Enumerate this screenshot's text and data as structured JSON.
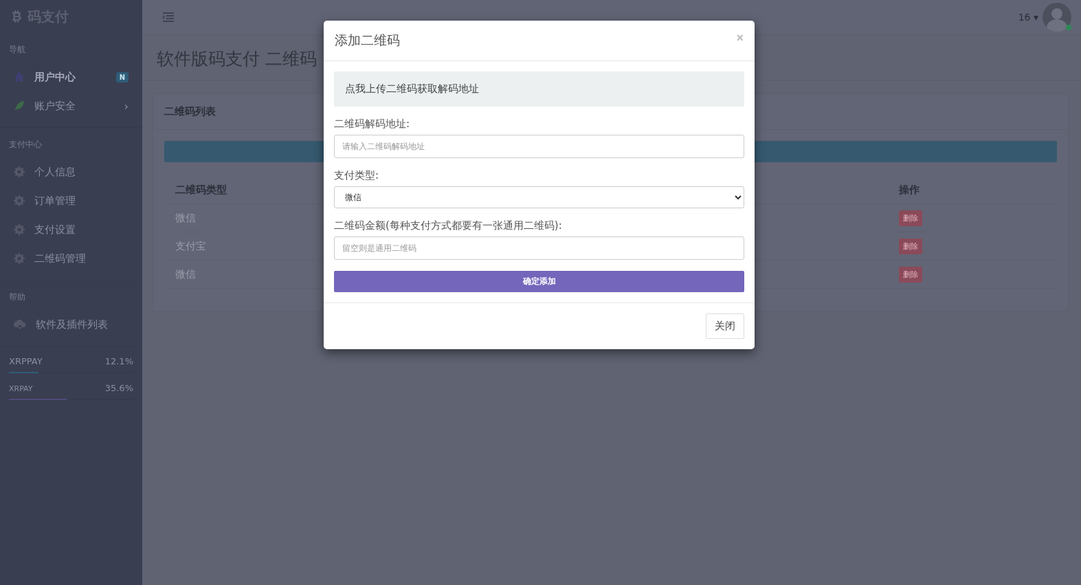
{
  "brand": {
    "name": "码支付"
  },
  "sidebar": {
    "sections": [
      {
        "title": "导航",
        "items": [
          {
            "label": "用户中心",
            "kind": "home",
            "selected": true,
            "badge": "N"
          },
          {
            "label": "账户安全",
            "kind": "leaf",
            "selected": false,
            "chevron": "›"
          }
        ]
      },
      {
        "title": "支付中心",
        "items": [
          {
            "label": "个人信息",
            "kind": "gear",
            "selected": false
          },
          {
            "label": "订单管理",
            "kind": "gear",
            "selected": false
          },
          {
            "label": "支付设置",
            "kind": "gear",
            "selected": false
          },
          {
            "label": "二维码管理",
            "kind": "gear",
            "selected": false
          }
        ]
      },
      {
        "title": "帮助",
        "items": [
          {
            "label": "软件及插件列表",
            "kind": "cloud",
            "selected": false
          }
        ]
      }
    ],
    "progress": [
      {
        "name": "XRPPAY",
        "reading": "12.1%",
        "level": 0.24,
        "color": "#2f5d78"
      },
      {
        "name": "XRPAY",
        "reading": "35.6%",
        "level": 0.47,
        "color": "#4f4a78"
      }
    ]
  },
  "header": {
    "user": "16",
    "caret": "▾"
  },
  "page": {
    "title": "软件版码支付 二维码"
  },
  "card": {
    "title": "二维码列表",
    "table": {
      "columns": [
        "二维码类型",
        "操作"
      ],
      "rows": [
        {
          "type": "微信",
          "action": "删除"
        },
        {
          "type": "支付宝",
          "action": "删除"
        },
        {
          "type": "微信",
          "action": "删除"
        }
      ]
    }
  },
  "modal": {
    "title": "添加二维码",
    "close": "×",
    "upload": "点我上传二维码获取解码地址",
    "fields": [
      {
        "kind": "input",
        "label": "二维码解码地址:",
        "placeholder": "请输入二维码解码地址"
      },
      {
        "kind": "select",
        "label": "支付类型:",
        "value": "微信"
      },
      {
        "kind": "input",
        "label": "二维码金额(每种支付方式都要有一张通用二维码):",
        "placeholder": "留空则是通用二维码"
      }
    ],
    "submit": "确定添加",
    "footer_button": "关闭"
  }
}
